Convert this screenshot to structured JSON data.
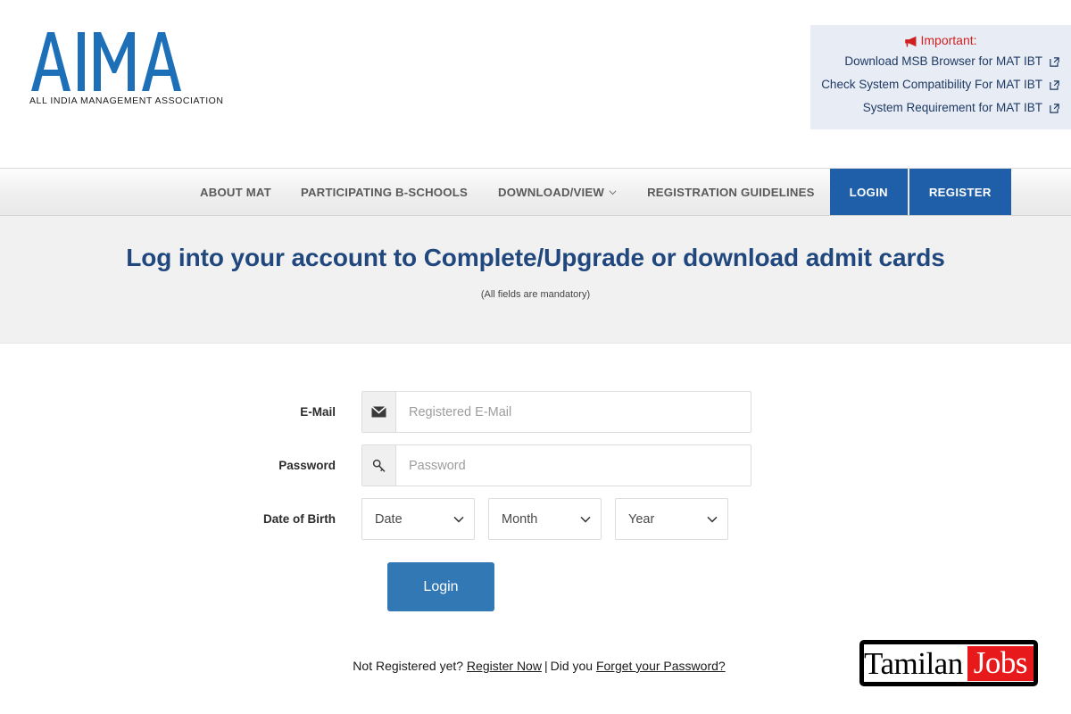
{
  "brand": {
    "logo_text": "AIMA",
    "logo_subtitle": "ALL INDIA MANAGEMENT ASSOCIATION",
    "logo_color": "#1d6fb8"
  },
  "notice": {
    "icon": "megaphone-icon",
    "title": "Important:",
    "title_color": "#d01f1f",
    "background": "#e7ecf5",
    "links": [
      {
        "label": "Download MSB Browser for MAT IBT",
        "icon": "external-link-icon"
      },
      {
        "label": "Check System Compatibility For MAT IBT",
        "icon": "external-link-icon"
      },
      {
        "label": "System Requirement for MAT IBT",
        "icon": "external-link-icon"
      }
    ]
  },
  "nav": {
    "items": [
      {
        "label": "ABOUT MAT",
        "has_caret": false
      },
      {
        "label": "PARTICIPATING B-SCHOOLS",
        "has_caret": false
      },
      {
        "label": "DOWNLOAD/VIEW",
        "has_caret": true
      },
      {
        "label": "REGISTRATION GUIDELINES",
        "has_caret": false
      }
    ],
    "buttons": [
      {
        "label": "LOGIN"
      },
      {
        "label": "REGISTER"
      }
    ],
    "button_color": "#1f5fa9"
  },
  "hero": {
    "title": "Log into your account to Complete/Upgrade or download admit cards",
    "title_color": "#21487e",
    "subtitle": "(All fields are mandatory)"
  },
  "form": {
    "email": {
      "label": "E-Mail",
      "placeholder": "Registered E-Mail",
      "value": "",
      "icon": "envelope-icon"
    },
    "password": {
      "label": "Password",
      "placeholder": "Password",
      "value": "",
      "icon": "key-icon"
    },
    "dob": {
      "label": "Date of Birth",
      "date": {
        "selected": "Date"
      },
      "month": {
        "selected": "Month"
      },
      "year": {
        "selected": "Year"
      }
    },
    "submit": {
      "label": "Login",
      "color": "#3178b4"
    }
  },
  "footer": {
    "not_registered_text": "Not Registered yet?",
    "register_link": "Register Now",
    "separator": "|",
    "did_you_text": "Did you",
    "forgot_link": "Forget your Password?"
  },
  "watermark": {
    "primary": "Tamilan",
    "accent": "Jobs",
    "accent_background": "#e8191b"
  }
}
